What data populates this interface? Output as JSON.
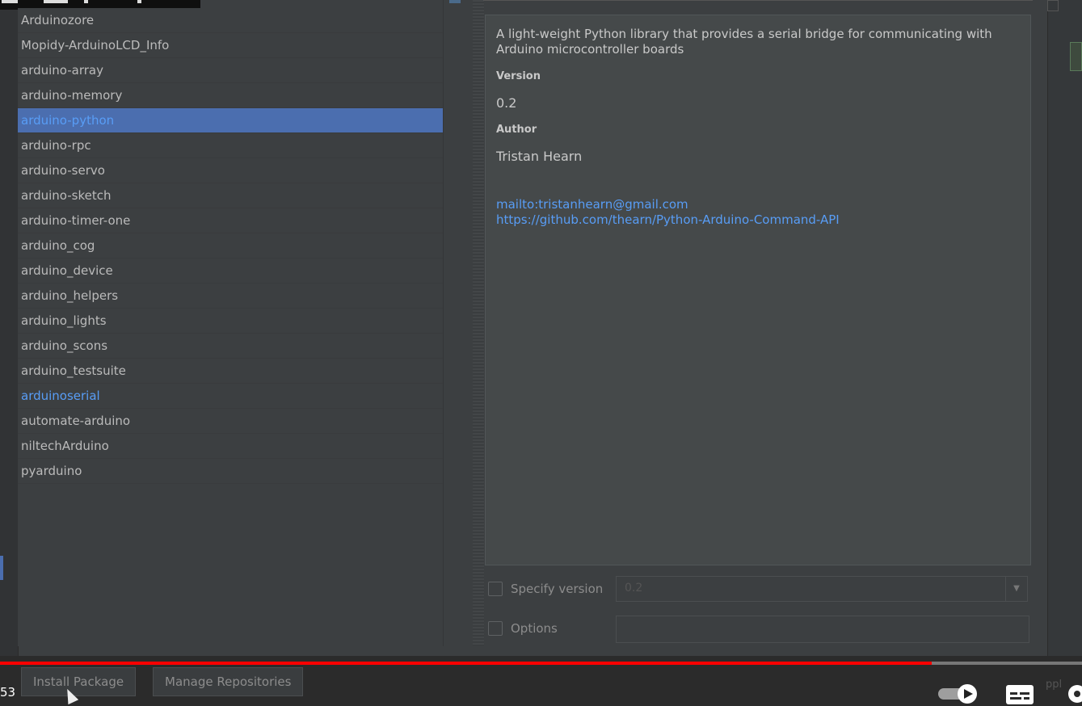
{
  "packages": [
    {
      "label": "Arduinozore",
      "state": "normal"
    },
    {
      "label": "Mopidy-ArduinoLCD_Info",
      "state": "normal"
    },
    {
      "label": "arduino-array",
      "state": "normal"
    },
    {
      "label": "arduino-memory",
      "state": "normal"
    },
    {
      "label": "arduino-python",
      "state": "selected"
    },
    {
      "label": "arduino-rpc",
      "state": "normal"
    },
    {
      "label": "arduino-servo",
      "state": "normal"
    },
    {
      "label": "arduino-sketch",
      "state": "normal"
    },
    {
      "label": "arduino-timer-one",
      "state": "normal"
    },
    {
      "label": "arduino_cog",
      "state": "normal"
    },
    {
      "label": "arduino_device",
      "state": "normal"
    },
    {
      "label": "arduino_helpers",
      "state": "normal"
    },
    {
      "label": "arduino_lights",
      "state": "normal"
    },
    {
      "label": "arduino_scons",
      "state": "normal"
    },
    {
      "label": "arduino_testsuite",
      "state": "normal"
    },
    {
      "label": "arduinoserial",
      "state": "installed"
    },
    {
      "label": "automate-arduino",
      "state": "normal"
    },
    {
      "label": "niltechArduino",
      "state": "normal"
    },
    {
      "label": "pyarduino",
      "state": "normal"
    }
  ],
  "description": {
    "text": "A light-weight Python library that provides a serial bridge for communicating with Arduino microcontroller boards",
    "version_label": "Version",
    "version_value": "0.2",
    "author_label": "Author",
    "author_value": "Tristan Hearn",
    "email_link": "mailto:tristanhearn@gmail.com",
    "homepage_link": "https://github.com/thearn/Python-Arduino-Command-API"
  },
  "options": {
    "specify_version_label": "Specify version",
    "version_select_value": "0.2",
    "options_label": "Options",
    "options_value": ""
  },
  "buttons": {
    "install": "Install Package",
    "manage_repos": "Manage Repositories"
  },
  "player": {
    "time_fragment": "53",
    "progress": 0.861,
    "right_fragment": "ppl"
  },
  "colors": {
    "selection": "#4b6eaf",
    "link": "#589df6",
    "progress": "#ff0000"
  }
}
